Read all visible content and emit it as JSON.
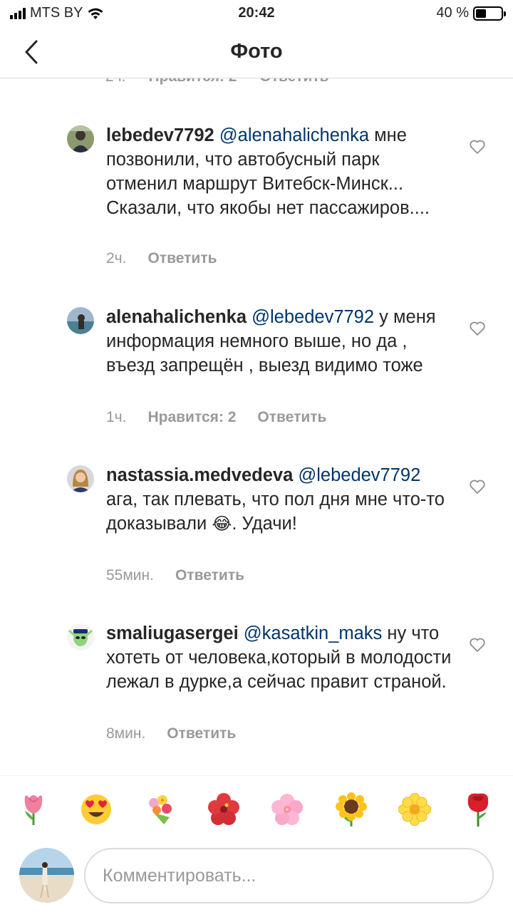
{
  "status_bar": {
    "carrier": "MTS BY",
    "time": "20:42",
    "battery": "40 %",
    "battery_level": 0.4
  },
  "header": {
    "title": "Фото"
  },
  "partial_comment": {
    "time": "2ч.",
    "likes": "Нравится: 2",
    "reply": "Ответить"
  },
  "comments": [
    {
      "username": "lebedev7792",
      "mention": "@alenahalichenka",
      "text": " мне позвонили, что автобусный парк отменил маршрут Витебск-Минск... Сказали, что якобы нет пассажиров....",
      "time": "2ч.",
      "reply": "Ответить"
    },
    {
      "username": "alenahalichenka",
      "mention": "@lebedev7792",
      "text": " у меня информация немного выше, но да , въезд запрещён , выезд видимо тоже",
      "time": "1ч.",
      "likes": "Нравится: 2",
      "reply": "Ответить"
    },
    {
      "username": "nastassia.medvedeva",
      "mention": "@lebedev7792",
      "text": " ага, так плевать, что пол дня мне что-то доказывали ",
      "emoji": "😂",
      "text_after": ". Удачи!",
      "time": "55мин.",
      "reply": "Ответить"
    },
    {
      "username": "smaliugasergei",
      "mention": "@kasatkin_maks",
      "text": " ну что хотеть от человека,который в молодости лежал в дурке,а сейчас правит страной.",
      "time": "8мин.",
      "reply": "Ответить"
    }
  ],
  "quick_emojis": [
    "tulip",
    "heart-eyes",
    "bouquet",
    "hibiscus",
    "cherry-blossom",
    "sunflower",
    "blossom",
    "rose"
  ],
  "input": {
    "placeholder": "Комментировать..."
  },
  "colors": {
    "text": "#262626",
    "mention": "#003569",
    "meta": "#999999",
    "border": "#dbdbdb"
  }
}
